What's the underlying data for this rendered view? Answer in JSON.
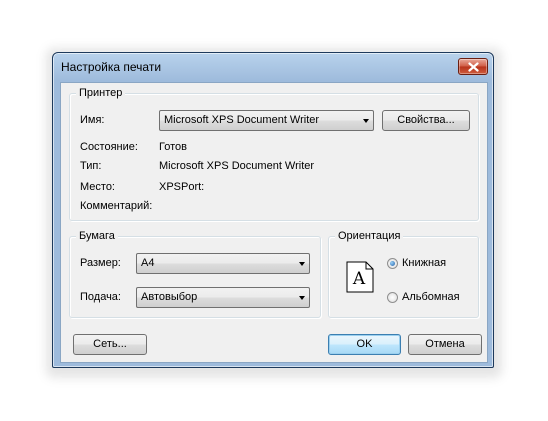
{
  "window": {
    "title": "Настройка печати"
  },
  "printer": {
    "group_label": "Принтер",
    "name_label": "Имя:",
    "name_value": "Microsoft XPS Document Writer",
    "properties_button": "Свойства...",
    "status_label": "Состояние:",
    "status_value": "Готов",
    "type_label": "Тип:",
    "type_value": "Microsoft XPS Document Writer",
    "where_label": "Место:",
    "where_value": "XPSPort:",
    "comment_label": "Комментарий:",
    "comment_value": ""
  },
  "paper": {
    "group_label": "Бумага",
    "size_label": "Размер:",
    "size_value": "A4",
    "source_label": "Подача:",
    "source_value": "Автовыбор"
  },
  "orientation": {
    "group_label": "Ориентация",
    "preview_letter": "A",
    "portrait_label": "Книжная",
    "landscape_label": "Альбомная",
    "selected": "portrait"
  },
  "buttons": {
    "network": "Сеть...",
    "ok": "OK",
    "cancel": "Отмена"
  },
  "colors": {
    "titlebar": "#b8d2ec",
    "client": "#f0f0f0",
    "close_button": "#c94a32",
    "default_button_border": "#3c7fb1"
  },
  "icons": {
    "close": "close-icon",
    "dropdown": "chevron-down-icon",
    "orientation_preview": "portrait-page-icon"
  }
}
